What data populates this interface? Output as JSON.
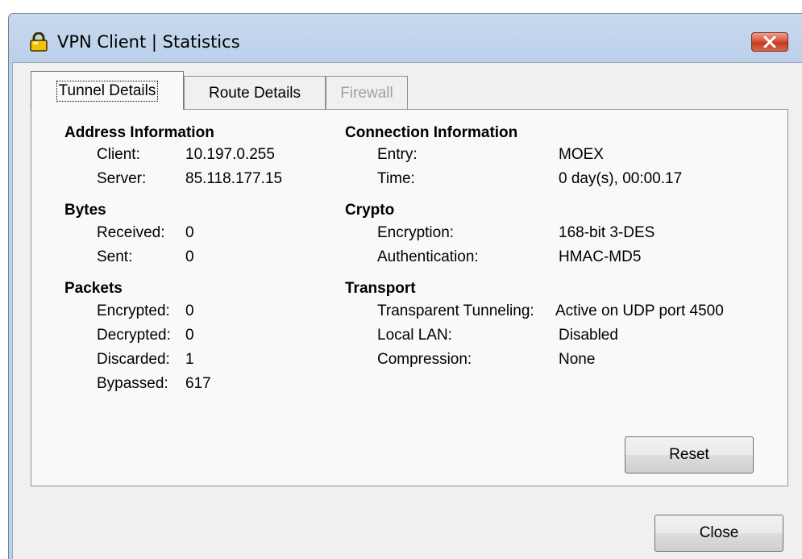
{
  "window": {
    "title": "VPN Client  |  Statistics",
    "title_icon": "padlock-icon",
    "close_icon": "close-icon"
  },
  "tabs": [
    {
      "label": "Tunnel Details",
      "active": true,
      "enabled": true
    },
    {
      "label": "Route Details",
      "active": false,
      "enabled": true
    },
    {
      "label": "Firewall",
      "active": false,
      "enabled": false
    }
  ],
  "address": {
    "heading": "Address Information",
    "client_label": "Client:",
    "client_value": "10.197.0.255",
    "server_label": "Server:",
    "server_value": "85.118.177.15"
  },
  "bytes": {
    "heading": "Bytes",
    "received_label": "Received:",
    "received_value": "0",
    "sent_label": "Sent:",
    "sent_value": "0"
  },
  "packets": {
    "heading": "Packets",
    "encrypted_label": "Encrypted:",
    "encrypted_value": "0",
    "decrypted_label": "Decrypted:",
    "decrypted_value": "0",
    "discarded_label": "Discarded:",
    "discarded_value": "1",
    "bypassed_label": "Bypassed:",
    "bypassed_value": "617"
  },
  "connection": {
    "heading": "Connection Information",
    "entry_label": "Entry:",
    "entry_value": "MOEX",
    "time_label": "Time:",
    "time_value": "0 day(s), 00:00.17"
  },
  "crypto": {
    "heading": "Crypto",
    "encryption_label": "Encryption:",
    "encryption_value": "168-bit 3-DES",
    "authentication_label": "Authentication:",
    "authentication_value": "HMAC-MD5"
  },
  "transport": {
    "heading": "Transport",
    "tunneling_label": "Transparent Tunneling:",
    "tunneling_value": "Active on UDP port 4500",
    "local_lan_label": "Local LAN:",
    "local_lan_value": "Disabled",
    "compression_label": "Compression:",
    "compression_value": "None"
  },
  "buttons": {
    "reset": "Reset",
    "close": "Close"
  },
  "colors": {
    "title_bar": "#bcd0ea",
    "close_button": "#c43a1e",
    "dialog_bg": "#f0f0f0",
    "disabled_text": "#a0a0a0"
  }
}
